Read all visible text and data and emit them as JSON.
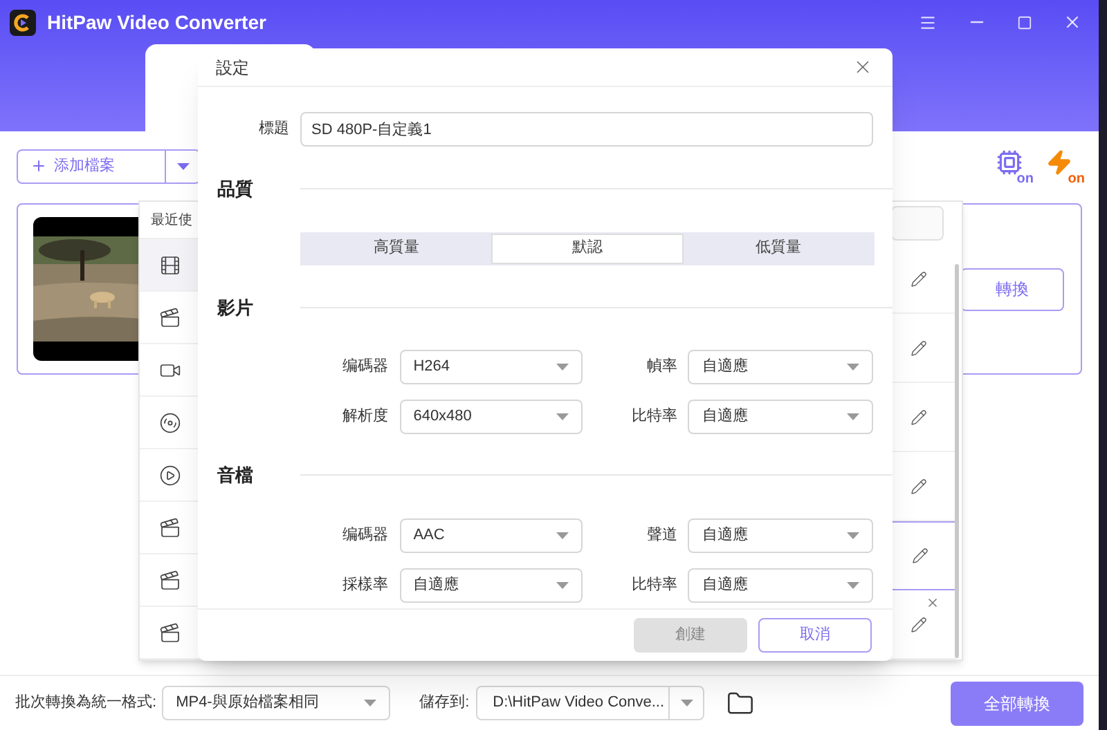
{
  "window": {
    "title": "HitPaw Video Converter"
  },
  "toolbar": {
    "add_button": "添加檔案",
    "gpu_badge": "on",
    "speed_badge": "on"
  },
  "file_card": {
    "convert_button": "轉換"
  },
  "format_panel": {
    "header": "最近使",
    "categories": [
      {
        "kind": "film",
        "selected": true
      },
      {
        "kind": "clapper",
        "selected": false
      },
      {
        "kind": "camera",
        "selected": false
      },
      {
        "kind": "reel",
        "selected": false
      },
      {
        "kind": "play",
        "selected": false
      },
      {
        "kind": "heic",
        "selected": false
      },
      {
        "kind": "heic",
        "selected": false
      },
      {
        "kind": "clapper",
        "selected": false
      }
    ],
    "presets": [
      {
        "selected": false,
        "removable": false
      },
      {
        "selected": false,
        "removable": false
      },
      {
        "selected": false,
        "removable": false
      },
      {
        "selected": false,
        "removable": false
      },
      {
        "selected": true,
        "removable": false
      },
      {
        "selected": false,
        "removable": true
      }
    ]
  },
  "dialog": {
    "title": "設定",
    "title_field": {
      "label": "標題",
      "value": "SD 480P-自定義1"
    },
    "quality": {
      "heading": "品質",
      "options": [
        {
          "label": "高質量",
          "selected": false
        },
        {
          "label": "默認",
          "selected": true
        },
        {
          "label": "低質量",
          "selected": false
        }
      ]
    },
    "video": {
      "heading": "影片",
      "fields": [
        {
          "label": "编碼器",
          "value": "H264"
        },
        {
          "label": "幀率",
          "value": "自適應"
        },
        {
          "label": "解析度",
          "value": "640x480"
        },
        {
          "label": "比特率",
          "value": "自適應"
        }
      ]
    },
    "audio": {
      "heading": "音檔",
      "fields": [
        {
          "label": "编碼器",
          "value": "AAC"
        },
        {
          "label": "聲道",
          "value": "自適應"
        },
        {
          "label": "採樣率",
          "value": "自適應"
        },
        {
          "label": "比特率",
          "value": "自適應"
        }
      ]
    },
    "buttons": [
      {
        "label": "創建",
        "disabled": true
      },
      {
        "label": "取消",
        "disabled": false
      }
    ]
  },
  "bottom_bar": {
    "format_label": "批次轉換為統一格式:",
    "format_value": "MP4-與原始檔案相同",
    "save_label": "儲存到:",
    "save_path": "D:\\HitPaw Video Conve...",
    "convert_all": "全部轉換"
  }
}
